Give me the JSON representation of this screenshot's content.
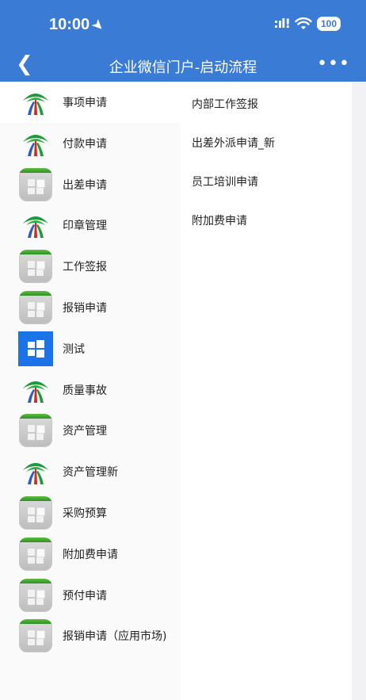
{
  "status_bar": {
    "time": "10:00",
    "signal": ":ıl!",
    "battery": "100"
  },
  "nav": {
    "back_icon": "chevron-left-icon",
    "title": "企业微信门户-启动流程",
    "more_icon": "more-dots-icon"
  },
  "categories": [
    {
      "label": "事项申请",
      "icon": "logo",
      "selected": true
    },
    {
      "label": "付款申请",
      "icon": "logo"
    },
    {
      "label": "出差申请",
      "icon": "gray"
    },
    {
      "label": "印章管理",
      "icon": "logo"
    },
    {
      "label": "工作签报",
      "icon": "gray"
    },
    {
      "label": "报销申请",
      "icon": "gray"
    },
    {
      "label": "测试",
      "icon": "windows"
    },
    {
      "label": "质量事故",
      "icon": "logo"
    },
    {
      "label": "资产管理",
      "icon": "gray"
    },
    {
      "label": "资产管理新",
      "icon": "logo"
    },
    {
      "label": "采购预算",
      "icon": "gray"
    },
    {
      "label": "附加费申请",
      "icon": "gray"
    },
    {
      "label": "预付申请",
      "icon": "gray"
    },
    {
      "label": "报销申请（应用市场)",
      "icon": "gray"
    }
  ],
  "subitems": [
    {
      "label": "内部工作签报"
    },
    {
      "label": "出差外派申请_新"
    },
    {
      "label": "员工培训申请"
    },
    {
      "label": "附加费申请"
    }
  ],
  "colors": {
    "header": "#3a7bd5",
    "logo_green": "#1f9a3a",
    "logo_red": "#d8261e",
    "logo_blue": "#2b5fb8"
  }
}
